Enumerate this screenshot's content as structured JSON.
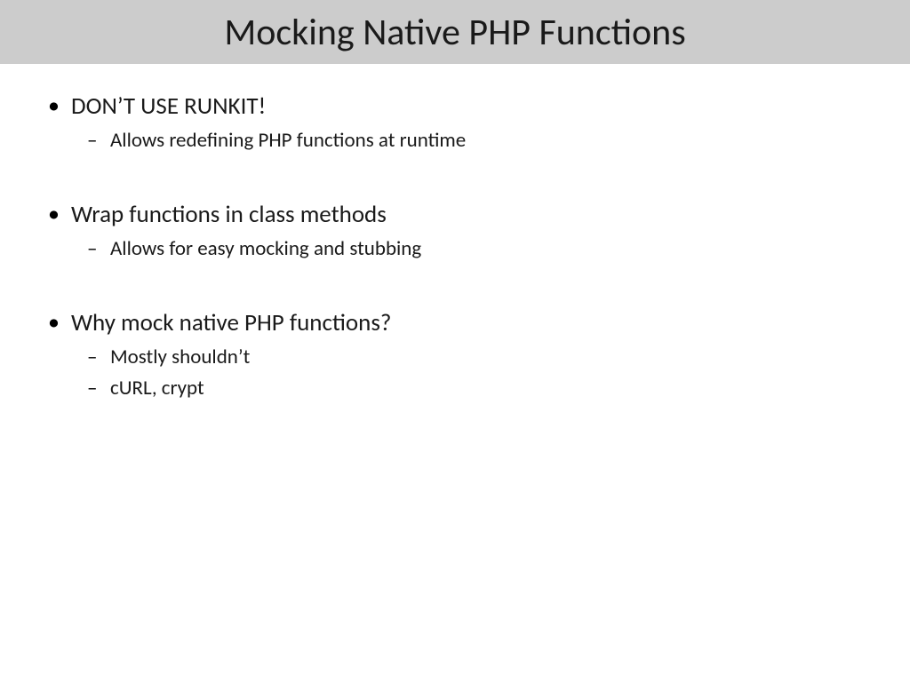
{
  "slide": {
    "title": "Mocking Native PHP Functions",
    "bullets": [
      {
        "text": "DON’T USE RUNKIT!",
        "sub": [
          "Allows redefining PHP functions at runtime"
        ]
      },
      {
        "text": "Wrap functions in class methods",
        "sub": [
          "Allows for easy mocking and stubbing"
        ]
      },
      {
        "text": "Why mock native PHP functions?",
        "sub": [
          "Mostly shouldn’t",
          "cURL, crypt"
        ]
      }
    ]
  }
}
